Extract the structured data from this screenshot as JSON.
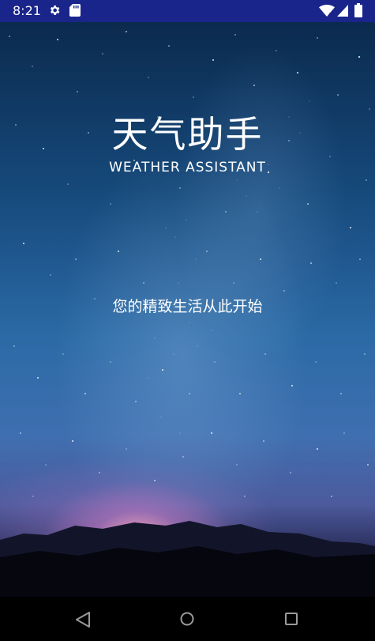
{
  "status_bar": {
    "time": "8:21",
    "icons": [
      "gear-icon",
      "sd-card-icon",
      "wifi-icon",
      "signal-icon",
      "battery-icon"
    ]
  },
  "app": {
    "title": "天气助手",
    "subtitle": "WEATHER ASSISTANT",
    "slogan": "您的精致生活从此开始"
  },
  "nav_bar": {
    "icons": [
      "back-icon",
      "home-icon",
      "recents-icon"
    ]
  },
  "colors": {
    "status_bar_bg": "#19258a",
    "text": "#ffffff",
    "nav_bar_bg": "#000000"
  }
}
